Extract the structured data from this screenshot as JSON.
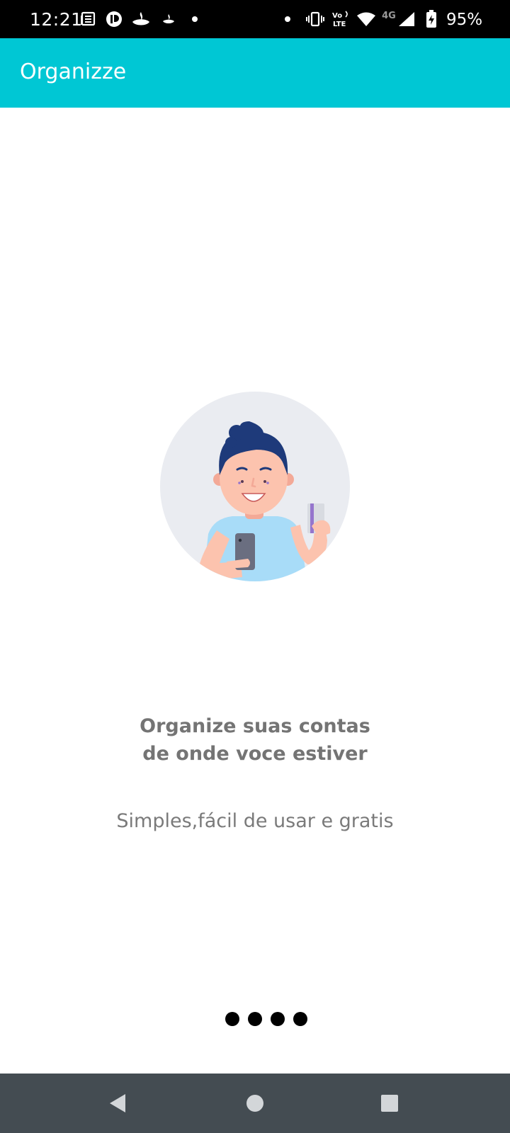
{
  "status_bar": {
    "time": "12:21",
    "battery_percent": "95%",
    "network_label": "4G",
    "volte_label": "Vo LTE",
    "left_icons": [
      "news-icon",
      "app-icon",
      "santander-icon",
      "santander-small-icon",
      "dot-icon"
    ],
    "right_icons": [
      "dot-icon",
      "vibrate-icon",
      "volte-icon",
      "wifi-icon",
      "signal-icon",
      "battery-charging-icon"
    ]
  },
  "app_bar": {
    "title": "Organizze",
    "color": "#00c7d4"
  },
  "onboarding": {
    "headline_line1": "Organize suas contas",
    "headline_line2": "de onde voce estiver",
    "subtitle": "Simples,fácil de usar e gratis",
    "illustration": "person-with-phone-and-card-illustration",
    "page_count": 4
  },
  "nav_bar": {
    "icons": [
      "back-icon",
      "home-icon",
      "recents-icon"
    ]
  }
}
